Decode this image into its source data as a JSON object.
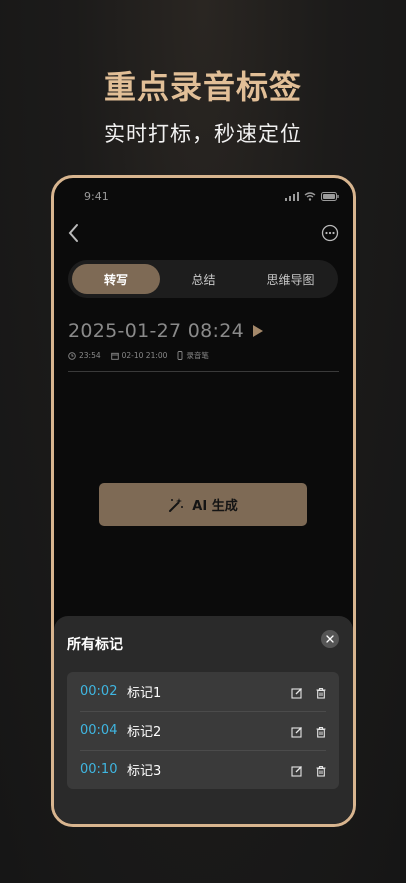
{
  "promo": {
    "headline": "重点录音标签",
    "subline": "实时打标，秒速定位"
  },
  "status_bar": {
    "time": "9:41"
  },
  "tabs": [
    {
      "label": "转写",
      "active": true
    },
    {
      "label": "总结",
      "active": false
    },
    {
      "label": "思维导图",
      "active": false
    }
  ],
  "recording": {
    "title": "2025-01-27 08:24",
    "duration": "23:54",
    "date": "02-10 21:00",
    "source": "录音笔"
  },
  "ai_button": {
    "label": "AI 生成"
  },
  "sheet": {
    "title": "所有标记",
    "marks": [
      {
        "time": "00:02",
        "label": "标记1"
      },
      {
        "time": "00:04",
        "label": "标记2"
      },
      {
        "time": "00:10",
        "label": "标记3"
      }
    ]
  },
  "colors": {
    "accent": "#d8b58f",
    "brand_button": "#7e6a55",
    "timestamp": "#3fb6e1",
    "headline": "#e2bf97"
  },
  "icons": [
    "back-icon",
    "more-icon",
    "play-icon",
    "clock-icon",
    "calendar-icon",
    "recorder-icon",
    "magic-wand-icon",
    "close-icon",
    "edit-icon",
    "delete-icon",
    "signal-icon",
    "wifi-icon",
    "battery-icon"
  ]
}
